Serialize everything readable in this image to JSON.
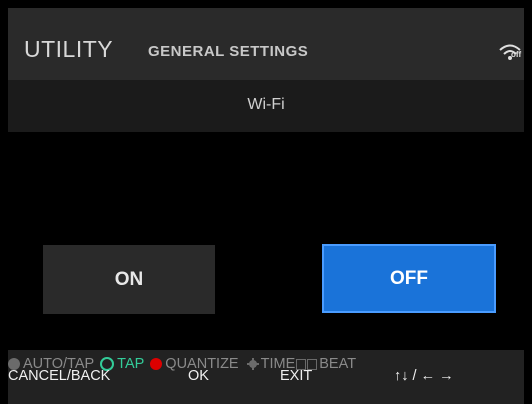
{
  "header": {
    "title": "UTILITY",
    "subtitle": "GENERAL SETTINGS",
    "wifi_status": "off",
    "wifi_icon": "wifi-off-icon"
  },
  "subbar": {
    "label": "Wi-Fi"
  },
  "options": [
    {
      "label": "ON",
      "selected": false
    },
    {
      "label": "OFF",
      "selected": true
    }
  ],
  "footer": {
    "indicators": [
      {
        "label": "AUTO/TAP",
        "color": "#6b6b6b"
      },
      {
        "label": "TAP",
        "color": "#33cc99"
      },
      {
        "label": "QUANTIZE",
        "color": "#dd0000"
      },
      {
        "label": "TIME",
        "color": "#6b6b6b"
      },
      {
        "label": "BEAT",
        "color": "#6b6b6b"
      }
    ],
    "keys": [
      "CANCEL/BACK",
      "OK",
      "EXIT",
      "↑↓ / ← →"
    ]
  },
  "colors": {
    "selected": "#1a73d9",
    "unselected": "#2a2a2a",
    "background": "#000000"
  }
}
